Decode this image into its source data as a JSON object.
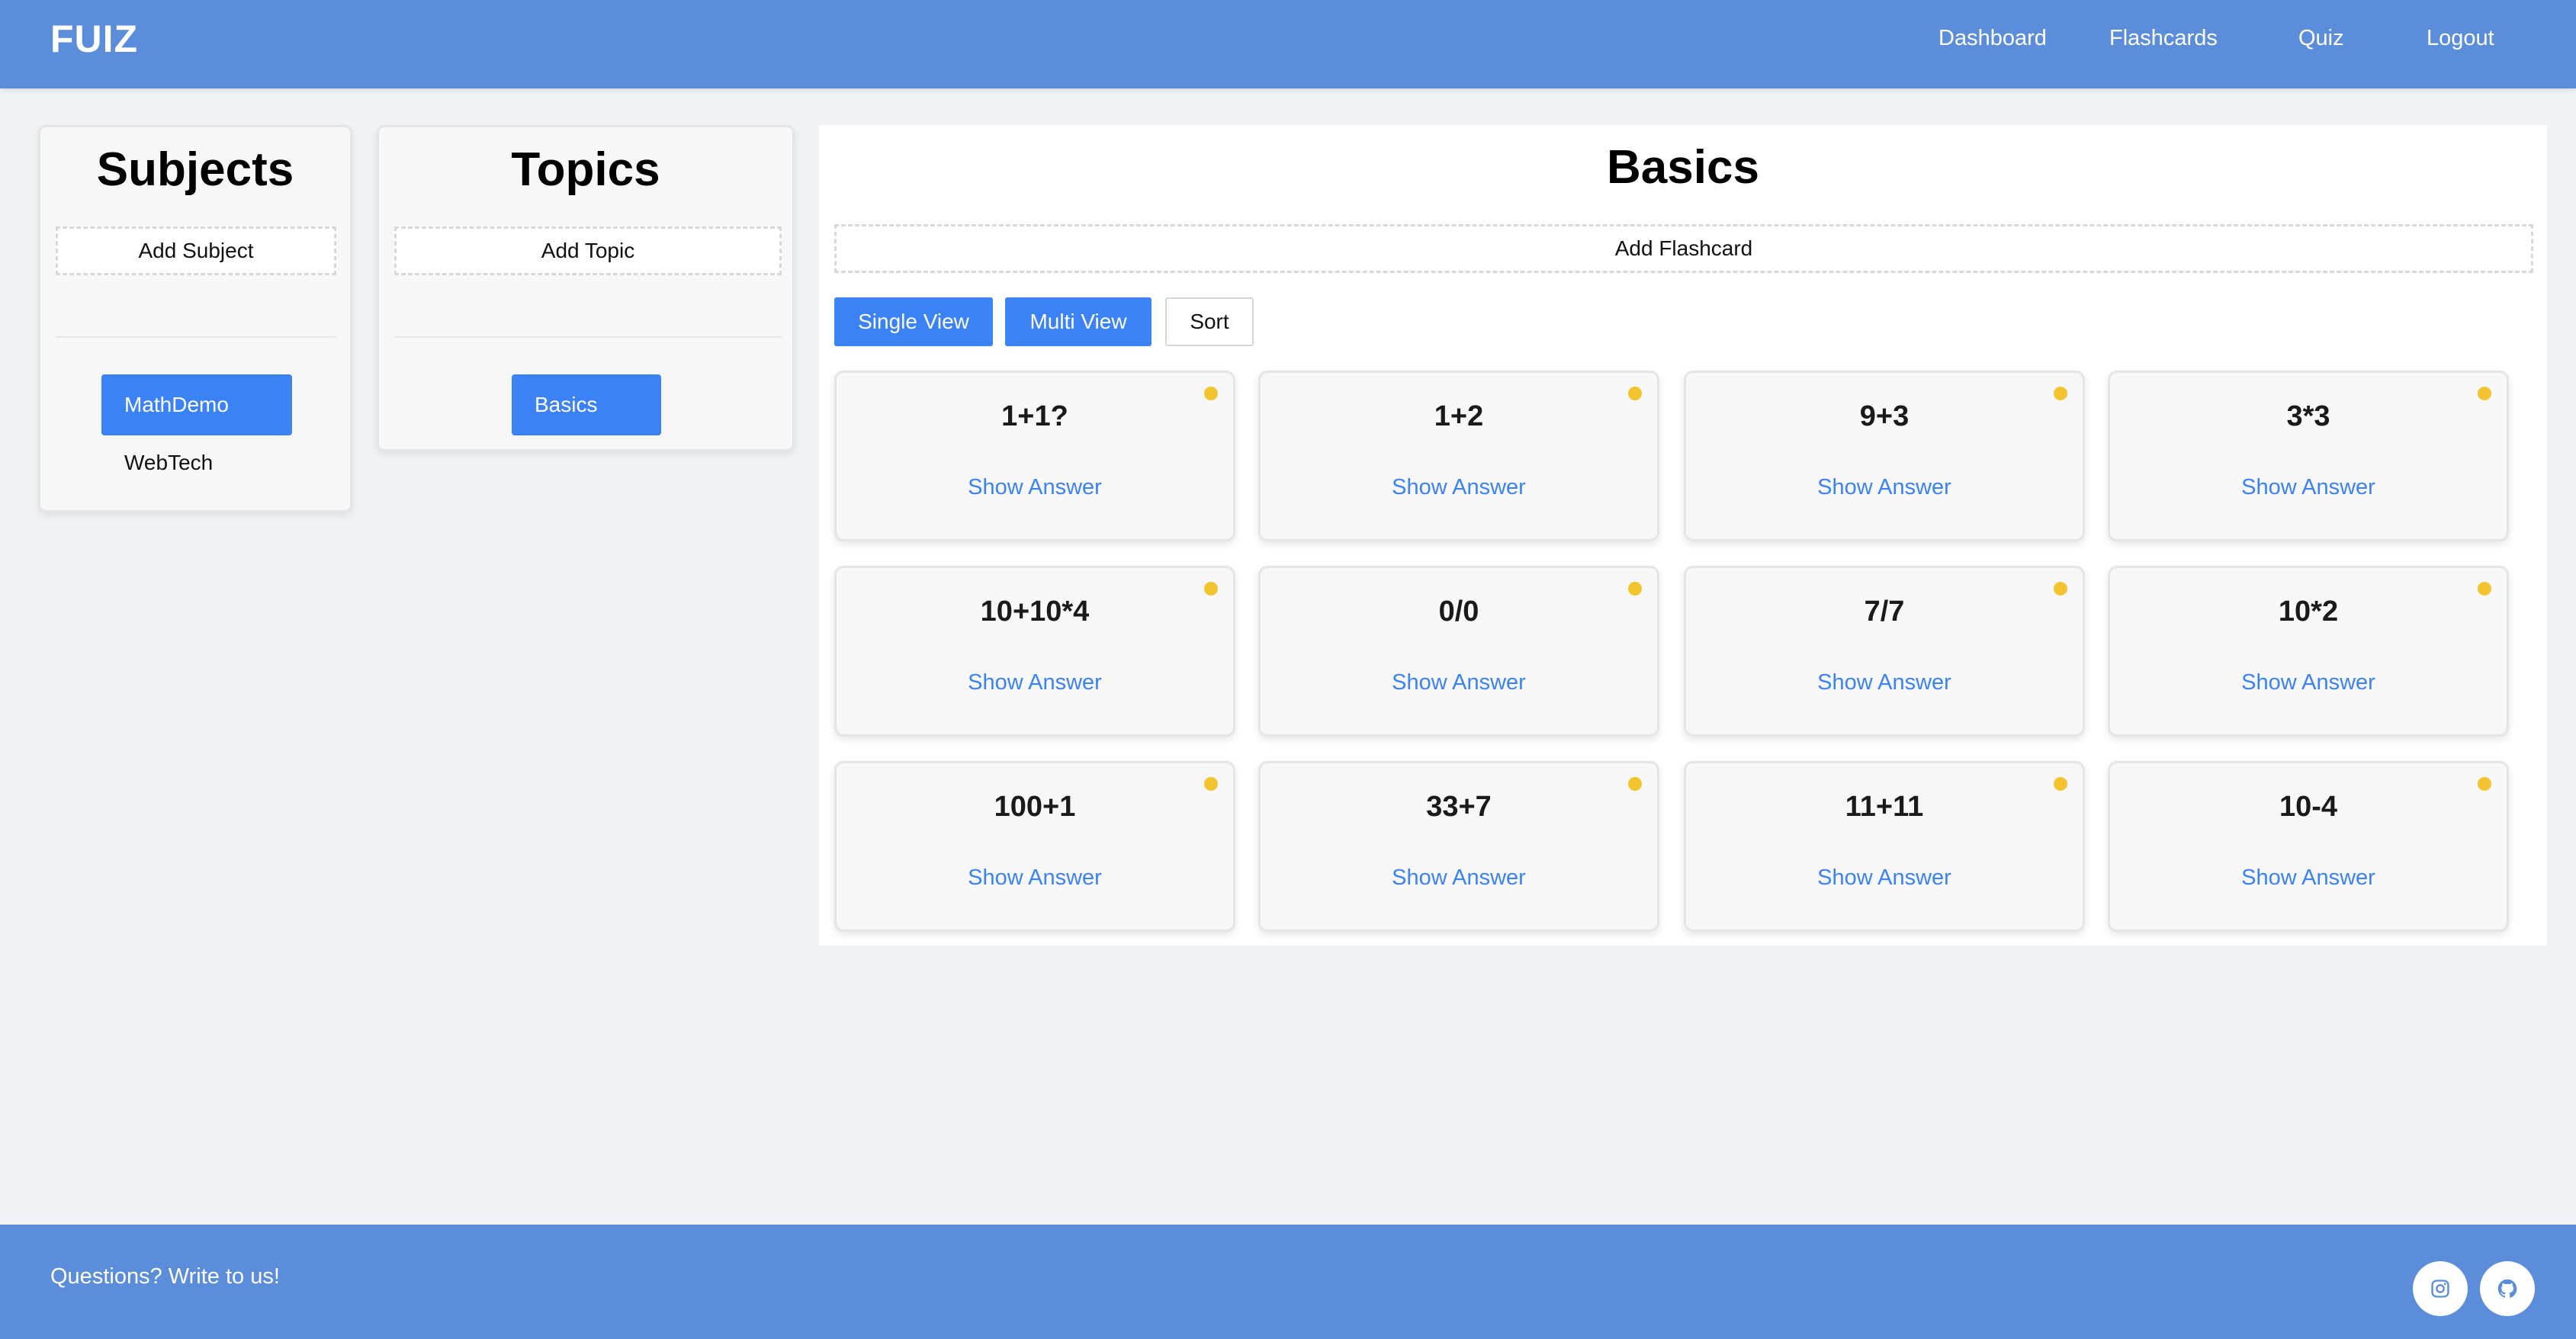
{
  "header": {
    "brand": "FUIZ",
    "nav": [
      "Dashboard",
      "Flashcards",
      "Quiz",
      "Logout"
    ]
  },
  "subjects": {
    "title": "Subjects",
    "add_label": "Add Subject",
    "items": [
      {
        "label": "MathDemo",
        "active": true
      },
      {
        "label": "WebTech",
        "active": false
      }
    ]
  },
  "topics": {
    "title": "Topics",
    "add_label": "Add Topic",
    "items": [
      {
        "label": "Basics",
        "active": true
      }
    ]
  },
  "main": {
    "title": "Basics",
    "add_label": "Add Flashcard",
    "buttons": {
      "single_view": "Single View",
      "multi_view": "Multi View",
      "sort": "Sort"
    },
    "answer_label": "Show Answer",
    "cards": [
      "1+1?",
      "1+2",
      "9+3",
      "3*3",
      "10+10*4",
      "0/0",
      "7/7",
      "10*2",
      "100+1",
      "33+7",
      "11+11",
      "10-4"
    ]
  },
  "footer": {
    "text": "Questions? Write to us!",
    "icons": [
      "instagram-icon",
      "github-icon"
    ]
  },
  "colors": {
    "header_bg": "#5b8ddb",
    "accent": "#3b82f6",
    "status_dot": "#f4c430",
    "page_bg": "#f0f2f5"
  }
}
